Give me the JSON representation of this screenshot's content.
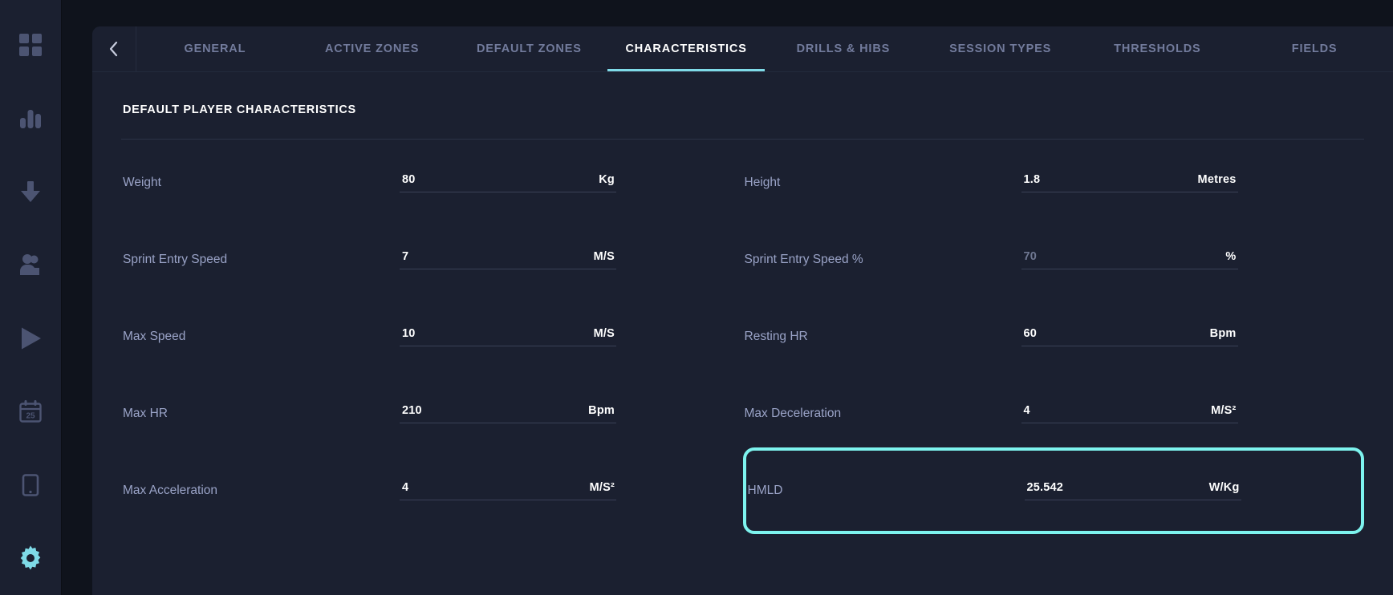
{
  "sidebar": {
    "items": [
      {
        "name": "dashboard-grid",
        "icon": "grid-icon",
        "active": false
      },
      {
        "name": "reports",
        "icon": "bar-chart-icon",
        "active": false
      },
      {
        "name": "downloads",
        "icon": "download-arrow-icon",
        "active": false
      },
      {
        "name": "athletes",
        "icon": "people-icon",
        "active": false
      },
      {
        "name": "live",
        "icon": "play-icon",
        "active": false
      },
      {
        "name": "calendar",
        "icon": "calendar-icon",
        "label": "25",
        "active": false
      },
      {
        "name": "devices",
        "icon": "tablet-icon",
        "active": false
      },
      {
        "name": "settings",
        "icon": "gear-icon",
        "active": true
      }
    ]
  },
  "header": {
    "back_label": "‹",
    "tabs": [
      {
        "label": "GENERAL",
        "active": false
      },
      {
        "label": "ACTIVE ZONES",
        "active": false
      },
      {
        "label": "DEFAULT ZONES",
        "active": false
      },
      {
        "label": "CHARACTERISTICS",
        "active": true
      },
      {
        "label": "DRILLS & HIBS",
        "active": false
      },
      {
        "label": "SESSION TYPES",
        "active": false
      },
      {
        "label": "THRESHOLDS",
        "active": false
      },
      {
        "label": "FIELDS",
        "active": false
      }
    ]
  },
  "content": {
    "section_title": "DEFAULT PLAYER CHARACTERISTICS",
    "left_fields": [
      {
        "label": "Weight",
        "value": "80",
        "unit": "Kg",
        "placeholder": false,
        "highlight": false
      },
      {
        "label": "Sprint Entry Speed",
        "value": "7",
        "unit": "M/S",
        "placeholder": false,
        "highlight": false
      },
      {
        "label": "Max Speed",
        "value": "10",
        "unit": "M/S",
        "placeholder": false,
        "highlight": false
      },
      {
        "label": "Max HR",
        "value": "210",
        "unit": "Bpm",
        "placeholder": false,
        "highlight": false
      },
      {
        "label": "Max Acceleration",
        "value": "4",
        "unit": "M/S²",
        "placeholder": false,
        "highlight": false
      }
    ],
    "right_fields": [
      {
        "label": "Height",
        "value": "1.8",
        "unit": "Metres",
        "placeholder": false,
        "highlight": false
      },
      {
        "label": "Sprint Entry Speed %",
        "value": "70",
        "unit": "%",
        "placeholder": true,
        "highlight": false
      },
      {
        "label": "Resting HR",
        "value": "60",
        "unit": "Bpm",
        "placeholder": false,
        "highlight": false
      },
      {
        "label": "Max Deceleration",
        "value": "4",
        "unit": "M/S²",
        "placeholder": false,
        "highlight": false
      },
      {
        "label": "HMLD",
        "value": "25.542",
        "unit": "W/Kg",
        "placeholder": false,
        "highlight": true
      }
    ]
  },
  "colors": {
    "accent": "#7fdbe8",
    "highlight_border": "#7df3ee",
    "panel_bg": "#1b2030",
    "app_bg": "#0f131c",
    "rail_bg": "#1b2030",
    "label_text": "#9aa3c7",
    "tab_inactive": "#727b9c"
  }
}
